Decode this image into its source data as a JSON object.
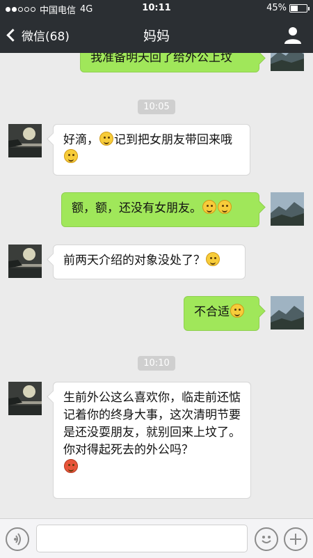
{
  "status_bar": {
    "carrier": "中国电信",
    "network": "4G",
    "time": "10:11",
    "battery": "45%",
    "battery_level": 0.45
  },
  "nav": {
    "back_label": "微信(68)",
    "title": "妈妈",
    "back_icon": "chevron-left-icon",
    "profile_icon": "person-icon"
  },
  "messages": {
    "m1": {
      "text": "我准备明天回了给外公上坟"
    },
    "ts1": "10:05",
    "m2": {
      "text_a": "好滴，",
      "text_b": "记到把女朋友带回来哦"
    },
    "m3": {
      "text": "额，额，还没有女朋友。"
    },
    "m4": {
      "text": "前两天介绍的对象没处了？"
    },
    "m5": {
      "text": "不合适"
    },
    "ts2": "10:10",
    "m6": {
      "text": "生前外公这么喜欢你，临走前还惦记着你的终身大事，这次清明节要是还没耍朋友，就别回来上坟了。你对得起死去的外公吗？"
    }
  },
  "input_bar": {
    "voice_icon": "voice-icon",
    "emoji_icon": "smiley-icon",
    "plus_icon": "plus-icon",
    "text_value": ""
  },
  "colors": {
    "nav_bg": "#2b2f33",
    "chat_bg": "#ebebeb",
    "own_bubble": "#a0e75a",
    "other_bubble": "#ffffff"
  }
}
